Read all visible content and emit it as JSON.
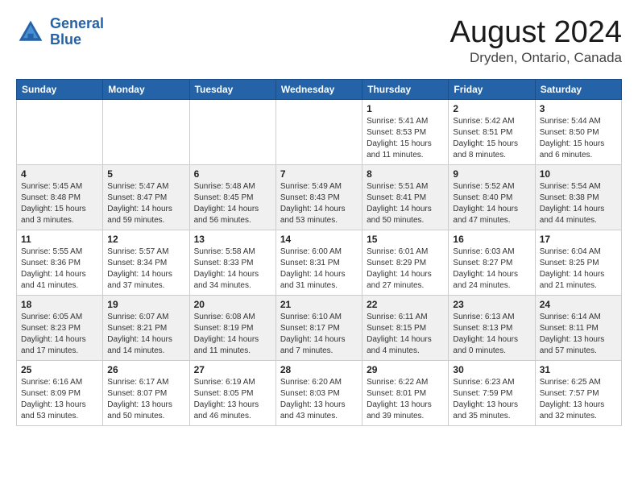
{
  "header": {
    "logo_line1": "General",
    "logo_line2": "Blue",
    "main_title": "August 2024",
    "subtitle": "Dryden, Ontario, Canada"
  },
  "calendar": {
    "days_of_week": [
      "Sunday",
      "Monday",
      "Tuesday",
      "Wednesday",
      "Thursday",
      "Friday",
      "Saturday"
    ],
    "weeks": [
      [
        {
          "day": "",
          "info": ""
        },
        {
          "day": "",
          "info": ""
        },
        {
          "day": "",
          "info": ""
        },
        {
          "day": "",
          "info": ""
        },
        {
          "day": "1",
          "info": "Sunrise: 5:41 AM\nSunset: 8:53 PM\nDaylight: 15 hours\nand 11 minutes."
        },
        {
          "day": "2",
          "info": "Sunrise: 5:42 AM\nSunset: 8:51 PM\nDaylight: 15 hours\nand 8 minutes."
        },
        {
          "day": "3",
          "info": "Sunrise: 5:44 AM\nSunset: 8:50 PM\nDaylight: 15 hours\nand 6 minutes."
        }
      ],
      [
        {
          "day": "4",
          "info": "Sunrise: 5:45 AM\nSunset: 8:48 PM\nDaylight: 15 hours\nand 3 minutes."
        },
        {
          "day": "5",
          "info": "Sunrise: 5:47 AM\nSunset: 8:47 PM\nDaylight: 14 hours\nand 59 minutes."
        },
        {
          "day": "6",
          "info": "Sunrise: 5:48 AM\nSunset: 8:45 PM\nDaylight: 14 hours\nand 56 minutes."
        },
        {
          "day": "7",
          "info": "Sunrise: 5:49 AM\nSunset: 8:43 PM\nDaylight: 14 hours\nand 53 minutes."
        },
        {
          "day": "8",
          "info": "Sunrise: 5:51 AM\nSunset: 8:41 PM\nDaylight: 14 hours\nand 50 minutes."
        },
        {
          "day": "9",
          "info": "Sunrise: 5:52 AM\nSunset: 8:40 PM\nDaylight: 14 hours\nand 47 minutes."
        },
        {
          "day": "10",
          "info": "Sunrise: 5:54 AM\nSunset: 8:38 PM\nDaylight: 14 hours\nand 44 minutes."
        }
      ],
      [
        {
          "day": "11",
          "info": "Sunrise: 5:55 AM\nSunset: 8:36 PM\nDaylight: 14 hours\nand 41 minutes."
        },
        {
          "day": "12",
          "info": "Sunrise: 5:57 AM\nSunset: 8:34 PM\nDaylight: 14 hours\nand 37 minutes."
        },
        {
          "day": "13",
          "info": "Sunrise: 5:58 AM\nSunset: 8:33 PM\nDaylight: 14 hours\nand 34 minutes."
        },
        {
          "day": "14",
          "info": "Sunrise: 6:00 AM\nSunset: 8:31 PM\nDaylight: 14 hours\nand 31 minutes."
        },
        {
          "day": "15",
          "info": "Sunrise: 6:01 AM\nSunset: 8:29 PM\nDaylight: 14 hours\nand 27 minutes."
        },
        {
          "day": "16",
          "info": "Sunrise: 6:03 AM\nSunset: 8:27 PM\nDaylight: 14 hours\nand 24 minutes."
        },
        {
          "day": "17",
          "info": "Sunrise: 6:04 AM\nSunset: 8:25 PM\nDaylight: 14 hours\nand 21 minutes."
        }
      ],
      [
        {
          "day": "18",
          "info": "Sunrise: 6:05 AM\nSunset: 8:23 PM\nDaylight: 14 hours\nand 17 minutes."
        },
        {
          "day": "19",
          "info": "Sunrise: 6:07 AM\nSunset: 8:21 PM\nDaylight: 14 hours\nand 14 minutes."
        },
        {
          "day": "20",
          "info": "Sunrise: 6:08 AM\nSunset: 8:19 PM\nDaylight: 14 hours\nand 11 minutes."
        },
        {
          "day": "21",
          "info": "Sunrise: 6:10 AM\nSunset: 8:17 PM\nDaylight: 14 hours\nand 7 minutes."
        },
        {
          "day": "22",
          "info": "Sunrise: 6:11 AM\nSunset: 8:15 PM\nDaylight: 14 hours\nand 4 minutes."
        },
        {
          "day": "23",
          "info": "Sunrise: 6:13 AM\nSunset: 8:13 PM\nDaylight: 14 hours\nand 0 minutes."
        },
        {
          "day": "24",
          "info": "Sunrise: 6:14 AM\nSunset: 8:11 PM\nDaylight: 13 hours\nand 57 minutes."
        }
      ],
      [
        {
          "day": "25",
          "info": "Sunrise: 6:16 AM\nSunset: 8:09 PM\nDaylight: 13 hours\nand 53 minutes."
        },
        {
          "day": "26",
          "info": "Sunrise: 6:17 AM\nSunset: 8:07 PM\nDaylight: 13 hours\nand 50 minutes."
        },
        {
          "day": "27",
          "info": "Sunrise: 6:19 AM\nSunset: 8:05 PM\nDaylight: 13 hours\nand 46 minutes."
        },
        {
          "day": "28",
          "info": "Sunrise: 6:20 AM\nSunset: 8:03 PM\nDaylight: 13 hours\nand 43 minutes."
        },
        {
          "day": "29",
          "info": "Sunrise: 6:22 AM\nSunset: 8:01 PM\nDaylight: 13 hours\nand 39 minutes."
        },
        {
          "day": "30",
          "info": "Sunrise: 6:23 AM\nSunset: 7:59 PM\nDaylight: 13 hours\nand 35 minutes."
        },
        {
          "day": "31",
          "info": "Sunrise: 6:25 AM\nSunset: 7:57 PM\nDaylight: 13 hours\nand 32 minutes."
        }
      ]
    ]
  }
}
